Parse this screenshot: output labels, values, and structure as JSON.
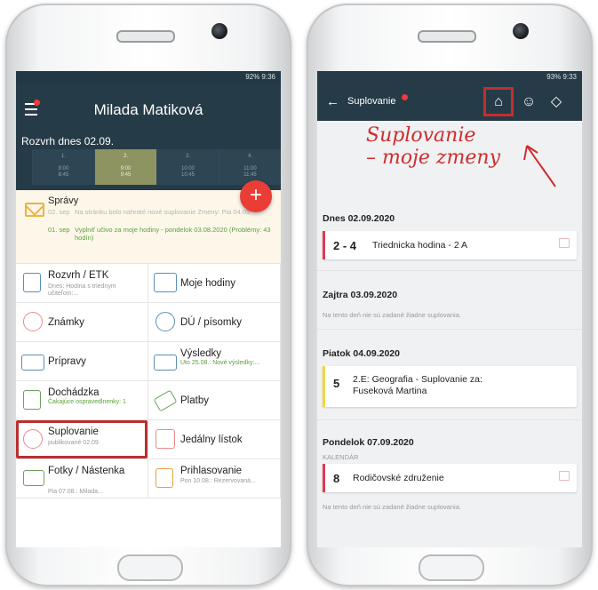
{
  "phone1": {
    "status": "92% 9:36",
    "user_name": "Milada Matiková",
    "schedule": {
      "title": "Rozvrh dnes 02.09.",
      "periods": [
        {
          "num": "1.",
          "time": "8:00\n8:45"
        },
        {
          "num": "2.",
          "time": "9:00\n9:45"
        },
        {
          "num": "3.",
          "time": "10:00\n10:45"
        },
        {
          "num": "4.",
          "time": "11:00\n11:45"
        }
      ]
    },
    "fab_label": "+",
    "messages": {
      "title": "Správy",
      "line1_date": "02. sep",
      "line1_text": "Na stránku bolo nahraté nové suplovanie Zmeny: Pia 04.09.",
      "line2_date": "01. sep",
      "line2_text": "Vyplniť učivo za moje hodiny - pondelok 03.08.2020 (Problémy: 43 hodín)"
    },
    "tiles": [
      {
        "title": "Rozvrh / ETK",
        "sub": "Dnes: Hodina s triednym učiteľom:..."
      },
      {
        "title": "Moje hodiny",
        "sub": ""
      },
      {
        "title": "Známky",
        "sub": ""
      },
      {
        "title": "DÚ / písomky",
        "sub": ""
      },
      {
        "title": "Prípravy",
        "sub": ""
      },
      {
        "title": "Výsledky",
        "sub": "Uto 25.08.: Nové výsledky:..."
      },
      {
        "title": "Dochádzka",
        "sub": "Čakajúce ospravedlnenky: 1"
      },
      {
        "title": "Platby",
        "sub": ""
      },
      {
        "title": "Suplovanie",
        "sub": "publikované 02.09."
      },
      {
        "title": "Jedálny lístok",
        "sub": ""
      },
      {
        "title": "Fotky / Nástenka",
        "sub": "Pia 07.08.: Milada..."
      },
      {
        "title": "Prihlasovanie",
        "sub": "Pon 10.08.: Rezervovaná..."
      }
    ]
  },
  "phone2": {
    "status": "93% 9:33",
    "bar_title": "Suplovanie",
    "annotation_line1": "Suplovanie",
    "annotation_line2": "– moje zmeny",
    "days": [
      {
        "heading": "Dnes 02.09.2020",
        "num": "2 - 4",
        "text": "Triednicka hodina - 2 A"
      },
      {
        "heading": "Zajtra 03.09.2020",
        "note": "Na tento deň nie sú zadané žiadne suplovania."
      },
      {
        "heading": "Piatok 04.09.2020",
        "num": "5",
        "text": "2.E: Geografia - Suplovanie za:\nFuseková Martina"
      },
      {
        "heading": "Pondelok 07.09.2020",
        "label": "KALENDÁR",
        "num": "8",
        "text": "Rodičovské združenie",
        "note": "Na tento deň nie sú zadané žiadne suplovania."
      }
    ]
  },
  "colors": {
    "appbar": "#263b48",
    "accent_red": "#ea3d36",
    "highlight_red": "#b92f2f",
    "green_text": "#5ca03c"
  }
}
